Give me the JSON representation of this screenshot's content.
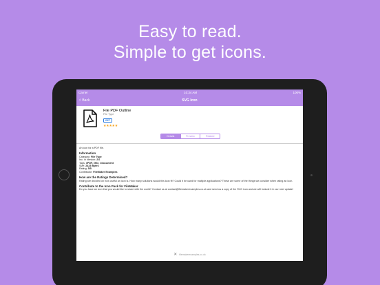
{
  "headline": {
    "line1": "Easy to read.",
    "line2": "Simple to get icons."
  },
  "status_bar": {
    "carrier": "Carrier",
    "time": "10:34 AM",
    "battery": "100%"
  },
  "nav": {
    "back_label": "Back",
    "title": "SVG Icon"
  },
  "app": {
    "name": "File PDF Outline",
    "subtitle": "File Type",
    "get_label": "GET",
    "stars": "★★★★★",
    "rating": 5
  },
  "segments": [
    {
      "label": "Details",
      "active": true
    },
    {
      "label": "Preview",
      "active": false
    },
    {
      "label": "Related",
      "active": false
    }
  ],
  "content": {
    "intro": "An icon for a PDF file.",
    "info_heading": "Information",
    "info_lines": [
      {
        "key": "Category: ",
        "value": "File Type"
      },
      {
        "key": "Inc. in Version: ",
        "value": "2.6"
      },
      {
        "key": "Tags: ",
        "value": "#PDF, #file, #document"
      },
      {
        "key": "Size: ",
        "value": "2423 Bytes"
      },
      {
        "key": "Rating: ",
        "value": "5/5"
      },
      {
        "key": "Contributor: ",
        "value": "FileMaker Examples"
      }
    ],
    "ratings_heading": "How are the Ratings Determined?",
    "ratings_text": "Rating are decided on how useful an icon is. How many solutions would this icon fit? Could it be used for multiple applications? These are some of the things we consider when rating an icon.",
    "contribute_heading": "Contribute to the Icon Pack for FileMaker",
    "contribute_text": "Do you have an icon that you would like to share with the world? Contact us at contact@filemakerexamples.co.uk and send us a copy of the SVG icon and we will include it in our next update!"
  },
  "footer": {
    "text": "filemakerexamples.co.uk"
  },
  "colors": {
    "background": "#b58be8",
    "accent": "#b58be8",
    "get_button": "#2f7de1",
    "stars": "#f6a623"
  }
}
